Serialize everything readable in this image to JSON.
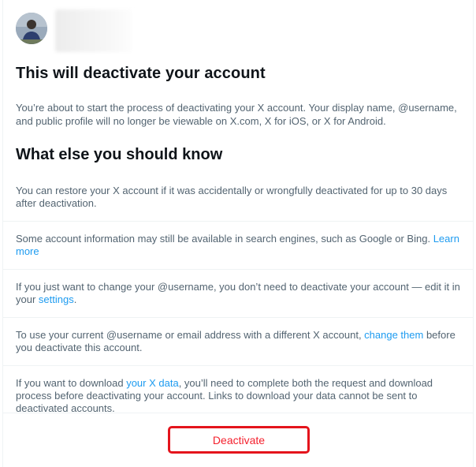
{
  "header": {
    "avatar_icon": "user-avatar"
  },
  "title": "This will deactivate your account",
  "intro": "You’re about to start the process of deactivating your X account. Your display name, @username, and public profile will no longer be viewable on X.com, X for iOS, or X for Android.",
  "subtitle": "What else you should know",
  "items": [
    {
      "text": "You can restore your X account if it was accidentally or wrongfully deactivated for up to 30 days after deactivation."
    },
    {
      "text_before": "Some account information may still be available in search engines, such as Google or Bing. ",
      "link": "Learn more",
      "text_after": ""
    },
    {
      "text_before": "If you just want to change your @username, you don’t need to deactivate your account — edit it in your ",
      "link": "settings",
      "text_after": "."
    },
    {
      "text_before": "To use your current @username or email address with a different X account, ",
      "link": "change them",
      "text_after": " before you deactivate this account."
    },
    {
      "text_before": "If you want to download ",
      "link": "your X data",
      "text_after": ", you’ll need to complete both the request and download process before deactivating your account. Links to download your data cannot be sent to deactivated accounts."
    }
  ],
  "footer": {
    "deactivate_label": "Deactivate"
  },
  "colors": {
    "primary_text": "#0f1419",
    "secondary_text": "#536471",
    "link": "#1d9bf0",
    "danger": "#f4212e",
    "highlight_border": "#e4141c",
    "divider": "#eff3f4"
  }
}
